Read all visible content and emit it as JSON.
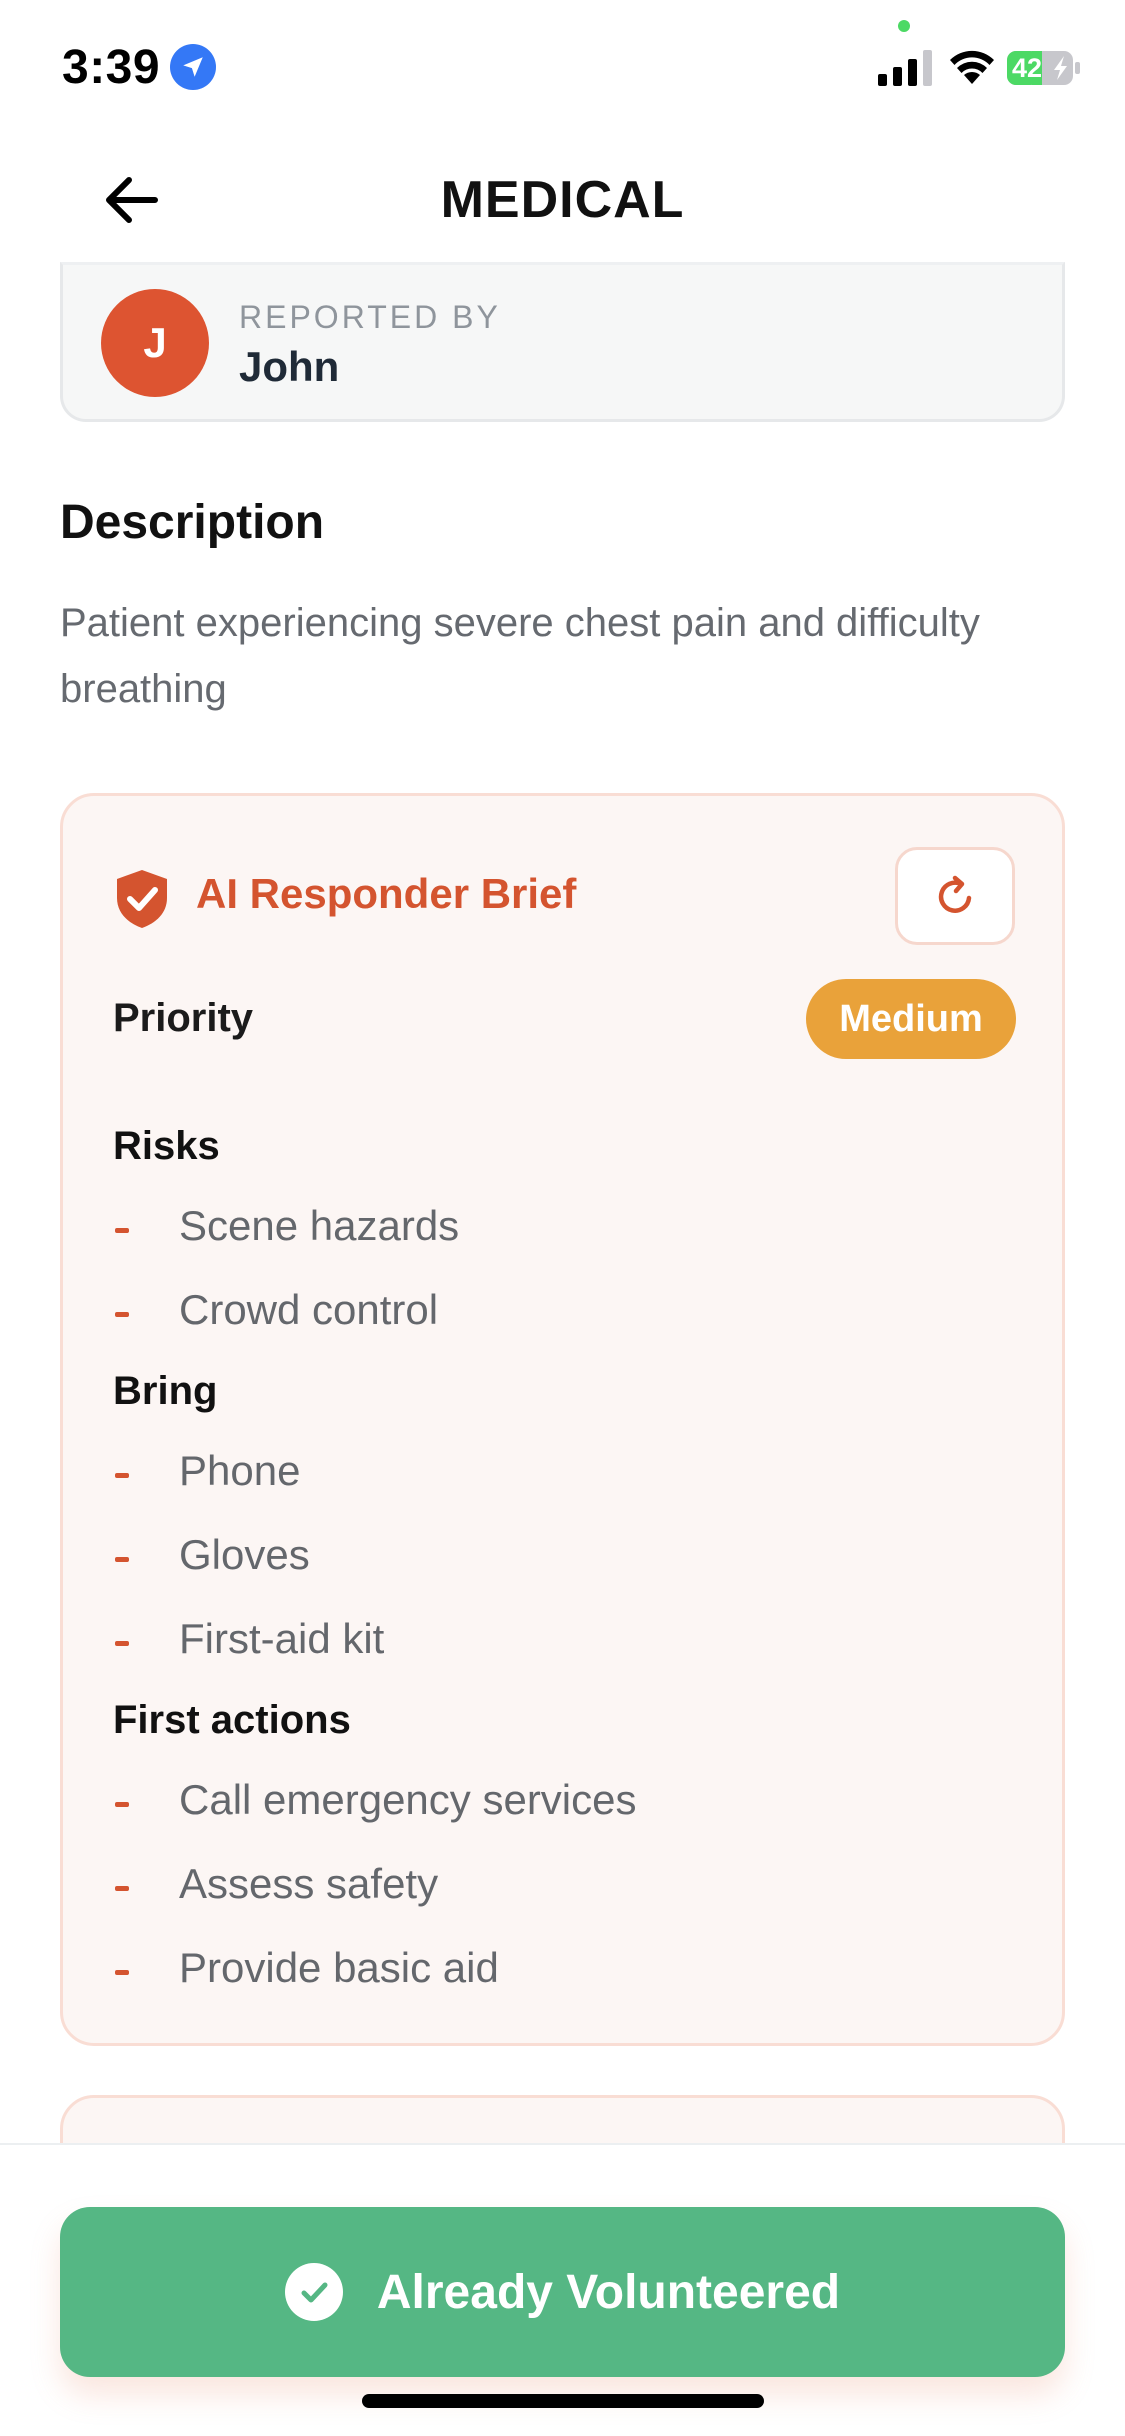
{
  "status_bar": {
    "time": "3:39",
    "battery_level": "42",
    "icons": [
      "location-arrow-icon",
      "signal-icon",
      "wifi-icon",
      "battery-charging-icon"
    ]
  },
  "header": {
    "title": "MEDICAL",
    "back_icon": "arrow-left-icon"
  },
  "reporter": {
    "label": "REPORTED BY",
    "name": "John",
    "initial": "J",
    "avatar_color": "#dd5431"
  },
  "description": {
    "heading": "Description",
    "text": "Patient experiencing severe chest pain and difficulty breathing"
  },
  "ai_brief": {
    "title": "AI Responder Brief",
    "icon": "shield-check-icon",
    "refresh_icon": "refresh-icon",
    "priority_label": "Priority",
    "priority_value": "Medium",
    "priority_color": "#e9a23a",
    "sections": [
      {
        "heading": "Risks",
        "items": [
          "Scene hazards",
          "Crowd control"
        ]
      },
      {
        "heading": "Bring",
        "items": [
          "Phone",
          "Gloves",
          "First-aid kit"
        ]
      },
      {
        "heading": "First actions",
        "items": [
          "Call emergency services",
          "Assess safety",
          "Provide basic aid"
        ]
      }
    ]
  },
  "action": {
    "label": "Already Volunteered",
    "icon": "check-circle-icon",
    "color": "#55b784"
  },
  "colors": {
    "accent": "#d4542f",
    "card_background": "#fcf6f4"
  }
}
